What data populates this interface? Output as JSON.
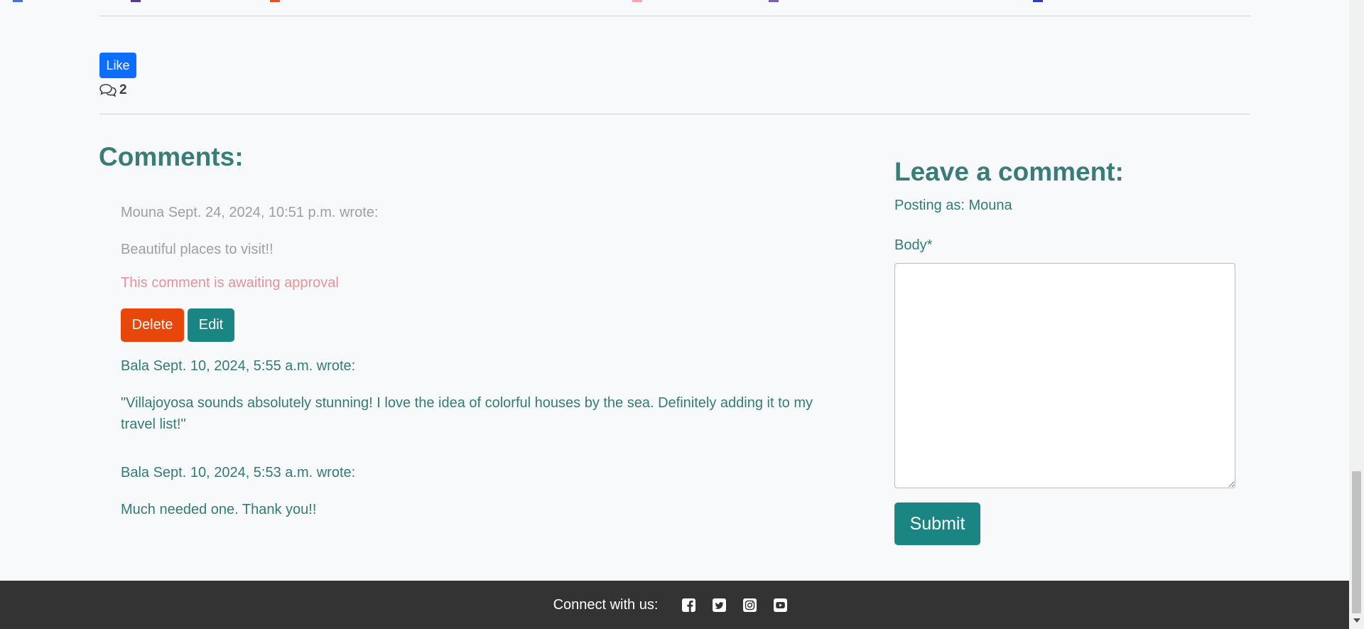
{
  "post_actions": {
    "like_label": "Like",
    "comment_count": "2"
  },
  "comments": {
    "heading": "Comments:",
    "items": [
      {
        "author_line": "Mouna Sept. 24, 2024, 10:51 p.m. wrote:",
        "body": "Beautiful places to visit!!",
        "pending_notice": "This comment is awaiting approval",
        "delete_label": "Delete",
        "edit_label": "Edit"
      },
      {
        "author_line": "Bala Sept. 10, 2024, 5:55 a.m. wrote:",
        "body": "\"Villajoyosa sounds absolutely stunning! I love the idea of colorful houses by the sea. Definitely adding it to my travel list!\""
      },
      {
        "author_line": "Bala Sept. 10, 2024, 5:53 a.m. wrote:",
        "body": "Much needed one. Thank you!!"
      }
    ]
  },
  "comment_form": {
    "heading": "Leave a comment:",
    "posting_as": "Posting as: Mouna",
    "body_label": "Body*",
    "body_value": "",
    "submit_label": "Submit"
  },
  "footer": {
    "connect_label": "Connect with us:",
    "social_icons": [
      "facebook-icon",
      "twitter-icon",
      "instagram-icon",
      "youtube-icon"
    ]
  },
  "colors": {
    "like_blue": "#0d6efd",
    "delete_orange": "#e8470b",
    "teal": "#1b8584",
    "heading_teal": "#3a7d78",
    "pending_pink": "#e8919c",
    "footer_bg": "#333333"
  }
}
